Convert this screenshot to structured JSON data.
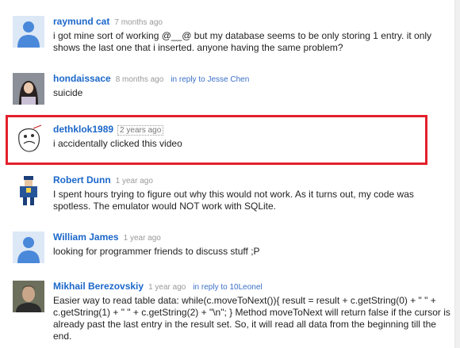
{
  "colors": {
    "author": "#1b67c9",
    "highlight": "#e3202c",
    "default_avatar": "#4a88d9"
  },
  "comments": [
    {
      "author": "raymund cat",
      "time": "7 months ago",
      "reply": "",
      "avatar": "default-avatar-icon",
      "text": "i got mine sort of working @__@ but my database seems to be only storing 1 entry. it only shows the last one that i inserted. anyone having the same problem?"
    },
    {
      "author": "hondaissace",
      "time": "8 months ago",
      "reply": "in reply to Jesse Chen",
      "avatar": "user-photo",
      "text": "suicide"
    },
    {
      "author": "dethklok1989",
      "time": "2 years ago",
      "reply": "",
      "avatar": "rage-face-avatar",
      "text": "i accidentally clicked this video"
    },
    {
      "author": "Robert Dunn",
      "time": "1 year ago",
      "reply": "",
      "avatar": "pixel-character-avatar",
      "text": "I spent hours trying to figure out why this would not work. As it turns out, my code was spotless. The emulator would NOT work with SQLite."
    },
    {
      "author": "William James",
      "time": "1 year ago",
      "reply": "",
      "avatar": "default-avatar-icon",
      "text": "looking for programmer friends to discuss stuff ;P"
    },
    {
      "author": "Mikhail Berezovskiy",
      "time": "1 year ago",
      "reply": "in reply to 10Leonel",
      "avatar": "user-photo",
      "text": "Easier way to read table data: while(c.moveToNext()){ result = result + c.getString(0) + \" \" + c.getString(1) + \" \" + c.getString(2) + \"\\n\"; } Method moveToNext will return false if the cursor is already past the last entry in the result set. So, it will read all data from the beginning till the end."
    }
  ]
}
